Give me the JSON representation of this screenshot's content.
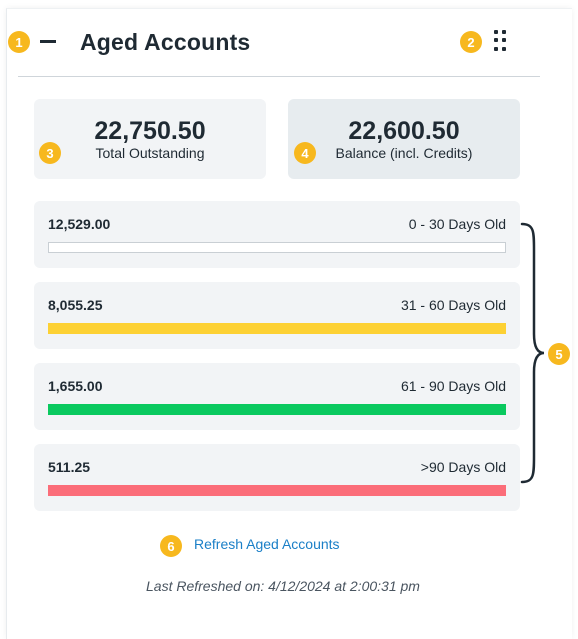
{
  "widget": {
    "title": "Aged Accounts",
    "collapse_icon": "minus-icon",
    "drag_icon": "drag-handle-icon"
  },
  "summary": {
    "total_outstanding": {
      "amount": "22,750.50",
      "label": "Total Outstanding"
    },
    "balance": {
      "amount": "22,600.50",
      "label": "Balance (incl. Credits)"
    }
  },
  "buckets": [
    {
      "amount": "12,529.00",
      "label": "0 - 30 Days Old",
      "color": "#ffffff",
      "fill_fraction": 0
    },
    {
      "amount": "8,055.25",
      "label": "31 - 60 Days Old",
      "color": "#fdd134",
      "fill_fraction": 1
    },
    {
      "amount": "1,655.00",
      "label": "61 - 90 Days Old",
      "color": "#0ac95f",
      "fill_fraction": 1
    },
    {
      "amount": "511.25",
      "label": ">90 Days Old",
      "color": "#fb6d79",
      "fill_fraction": 1
    }
  ],
  "refresh": {
    "label": "Refresh Aged Accounts"
  },
  "last_refreshed": "Last Refreshed on: 4/12/2024 at 2:00:31 pm",
  "callouts": [
    "1",
    "2",
    "3",
    "4",
    "5",
    "6"
  ],
  "colors": {
    "callout": "#f7b81e",
    "link": "#1a7fc7"
  }
}
